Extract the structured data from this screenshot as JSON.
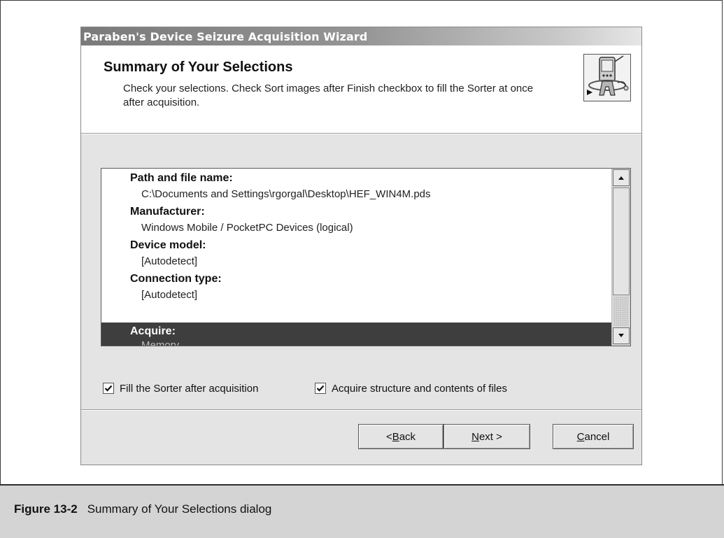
{
  "dialog": {
    "title": "Paraben's Device Seizure Acquisition Wizard",
    "header_title": "Summary of Your Selections",
    "header_description": "Check your selections. Check Sort images after Finish checkbox to fill the Sorter at once after acquisition."
  },
  "summary_list": {
    "items": [
      {
        "label": "Path and file name:",
        "value": "C:\\Documents and Settings\\rgorgal\\Desktop\\HEF_WIN4M.pds"
      },
      {
        "label": "Manufacturer:",
        "value": "Windows Mobile / PocketPC Devices (logical)"
      },
      {
        "label": "Device model:",
        "value": "[Autodetect]"
      },
      {
        "label": "Connection type:",
        "value": "[Autodetect]"
      },
      {
        "label": "Acquire:",
        "value": "Memory"
      }
    ],
    "selected_index": 4
  },
  "checkboxes": [
    {
      "label": "Fill the Sorter after acquisition",
      "checked": true
    },
    {
      "label": "Acquire structure and contents of files",
      "checked": true
    }
  ],
  "buttons": {
    "back": {
      "prefix": "< ",
      "mnemonic": "B",
      "rest": "ack"
    },
    "next": {
      "prefix": "",
      "mnemonic": "N",
      "rest": "ext >"
    },
    "cancel": {
      "prefix": "",
      "mnemonic": "C",
      "rest": "ancel"
    }
  },
  "caption": {
    "label": "Figure 13-2",
    "text": "Summary of Your Selections dialog"
  },
  "icons": {
    "wizard_icon": "pda-device-icon",
    "scroll_up": "arrow-up-icon",
    "scroll_down": "arrow-down-icon",
    "check": "checkmark-icon"
  }
}
